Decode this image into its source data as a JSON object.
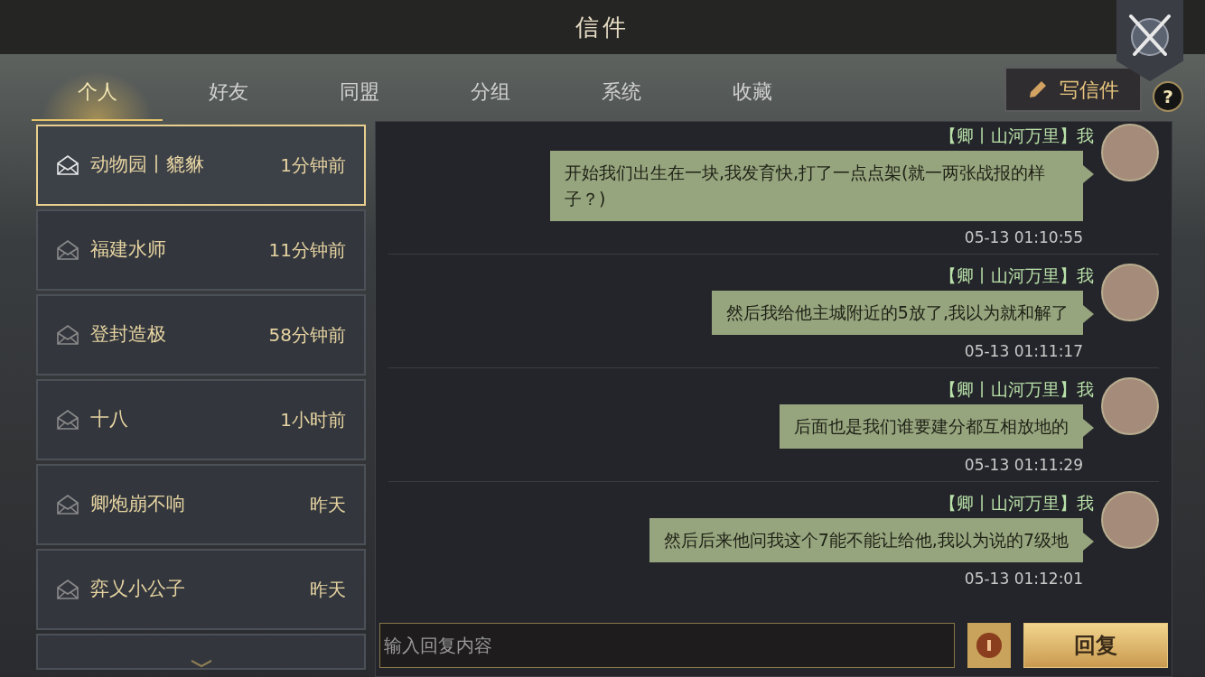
{
  "window": {
    "title": "信件"
  },
  "tabs": [
    {
      "label": "个人",
      "selected": true
    },
    {
      "label": "好友",
      "selected": false
    },
    {
      "label": "同盟",
      "selected": false
    },
    {
      "label": "分组",
      "selected": false
    },
    {
      "label": "系统",
      "selected": false
    },
    {
      "label": "收藏",
      "selected": false
    }
  ],
  "compose_button": {
    "label": "写信件"
  },
  "help_button": {
    "label": "?"
  },
  "mail_list": [
    {
      "name": "动物园丨貔貅",
      "time": "1分钟前",
      "selected": true
    },
    {
      "name": "福建水师",
      "time": "11分钟前",
      "selected": false
    },
    {
      "name": "登封造极",
      "time": "58分钟前",
      "selected": false
    },
    {
      "name": "十八",
      "time": "1小时前",
      "selected": false
    },
    {
      "name": "卿炮崩不响",
      "time": "昨天",
      "selected": false
    },
    {
      "name": "弈乂小公子",
      "time": "昨天",
      "selected": false
    }
  ],
  "messages": [
    {
      "sender": "【卿丨山河万里】我",
      "text": "开始我们出生在一块,我发育快,打了一点点架(就一两张战报的样子？)",
      "time": "05-13 01:10:55"
    },
    {
      "sender": "【卿丨山河万里】我",
      "text": "然后我给他主城附近的5放了,我以为就和解了",
      "time": "05-13 01:11:17"
    },
    {
      "sender": "【卿丨山河万里】我",
      "text": "后面也是我们谁要建分都互相放地的",
      "time": "05-13 01:11:29"
    },
    {
      "sender": "【卿丨山河万里】我",
      "text": "然后后来他问我这个7能不能让给他,我以为说的7级地",
      "time": "05-13 01:12:01"
    }
  ],
  "reply_input": {
    "placeholder": "输入回复内容"
  },
  "reply_button": {
    "label": "回复"
  }
}
